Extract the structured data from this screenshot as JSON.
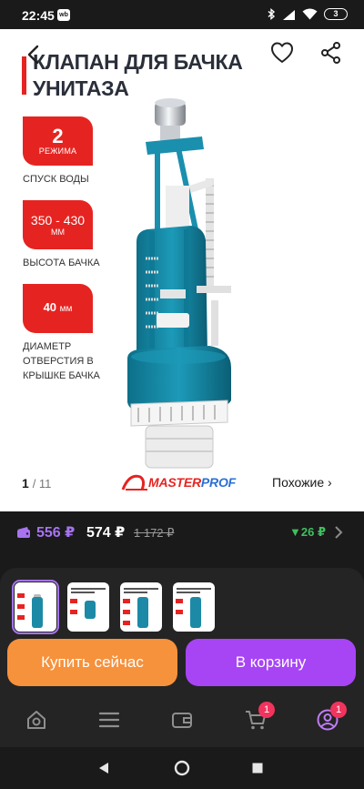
{
  "status_bar": {
    "time": "22:45",
    "app_badge": "wb",
    "battery": "3",
    "icons": [
      "bluetooth-icon",
      "signal-icon",
      "wifi-icon",
      "battery-icon"
    ]
  },
  "product": {
    "title_line1": "КЛАПАН ДЛЯ БАЧКА",
    "title_line2": "УНИТАЗА",
    "features": [
      {
        "value": "2",
        "unit": "РЕЖИМА",
        "caption": "СПУСК ВОДЫ"
      },
      {
        "value": "350 - 430",
        "unit": "ММ",
        "caption": "ВЫСОТА БАЧКА"
      },
      {
        "value": "40",
        "unit": "мм",
        "caption_lines": [
          "ДИАМЕТР",
          "ОТВЕРСТИЯ В",
          "КРЫШКЕ  БАЧКА"
        ]
      }
    ],
    "brand": {
      "part1": "MASTER",
      "part2": "PROF"
    },
    "accent_color": "#e52421",
    "product_color": "#1c8aa6"
  },
  "gallery": {
    "current": "1",
    "total": "/ 11",
    "similar_label": "Похожие ›"
  },
  "price": {
    "wallet_price": "556 ₽",
    "price": "574 ₽",
    "old_price": "1 172 ₽",
    "cashback": "▼26 ₽",
    "wallet_color": "#a773f0",
    "cashback_color": "#3fbf5f"
  },
  "thumbnails": [
    {
      "active": true
    },
    {
      "active": false
    },
    {
      "active": false
    },
    {
      "active": false
    }
  ],
  "actions": {
    "buy_now": "Купить сейчас",
    "add_to_cart": "В корзину",
    "buy_color": "#f6913c",
    "cart_color": "#a745f5"
  },
  "bottom_nav": {
    "items": [
      {
        "icon": "home-search-icon"
      },
      {
        "icon": "menu-icon"
      },
      {
        "icon": "wallet-icon"
      },
      {
        "icon": "cart-icon",
        "badge": "1"
      },
      {
        "icon": "profile-icon",
        "badge": "1"
      }
    ]
  },
  "system_nav": [
    "back-triangle-icon",
    "home-circle-icon",
    "recents-square-icon"
  ]
}
